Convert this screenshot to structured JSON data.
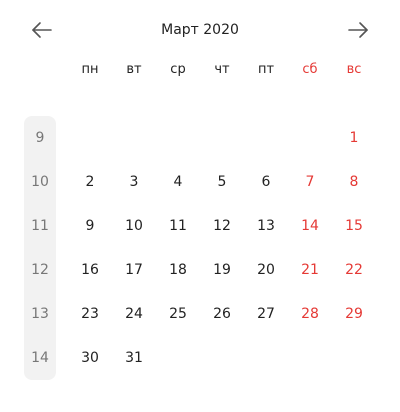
{
  "header": {
    "title": "Март 2020",
    "prev_icon": "arrow-left-icon",
    "next_icon": "arrow-right-icon"
  },
  "colors": {
    "weekend": "#e53935",
    "text": "#222222",
    "weeknum_bg": "#f2f2f2",
    "weeknum_text": "#777777"
  },
  "weekdays": [
    "пн",
    "вт",
    "ср",
    "чт",
    "пт",
    "сб",
    "вс"
  ],
  "weeks": [
    {
      "num": "9",
      "days": [
        "",
        "",
        "",
        "",
        "",
        "",
        "1"
      ]
    },
    {
      "num": "10",
      "days": [
        "2",
        "3",
        "4",
        "5",
        "6",
        "7",
        "8"
      ]
    },
    {
      "num": "11",
      "days": [
        "9",
        "10",
        "11",
        "12",
        "13",
        "14",
        "15"
      ]
    },
    {
      "num": "12",
      "days": [
        "16",
        "17",
        "18",
        "19",
        "20",
        "21",
        "22"
      ]
    },
    {
      "num": "13",
      "days": [
        "23",
        "24",
        "25",
        "26",
        "27",
        "28",
        "29"
      ]
    },
    {
      "num": "14",
      "days": [
        "30",
        "31",
        "",
        "",
        "",
        "",
        ""
      ]
    }
  ]
}
